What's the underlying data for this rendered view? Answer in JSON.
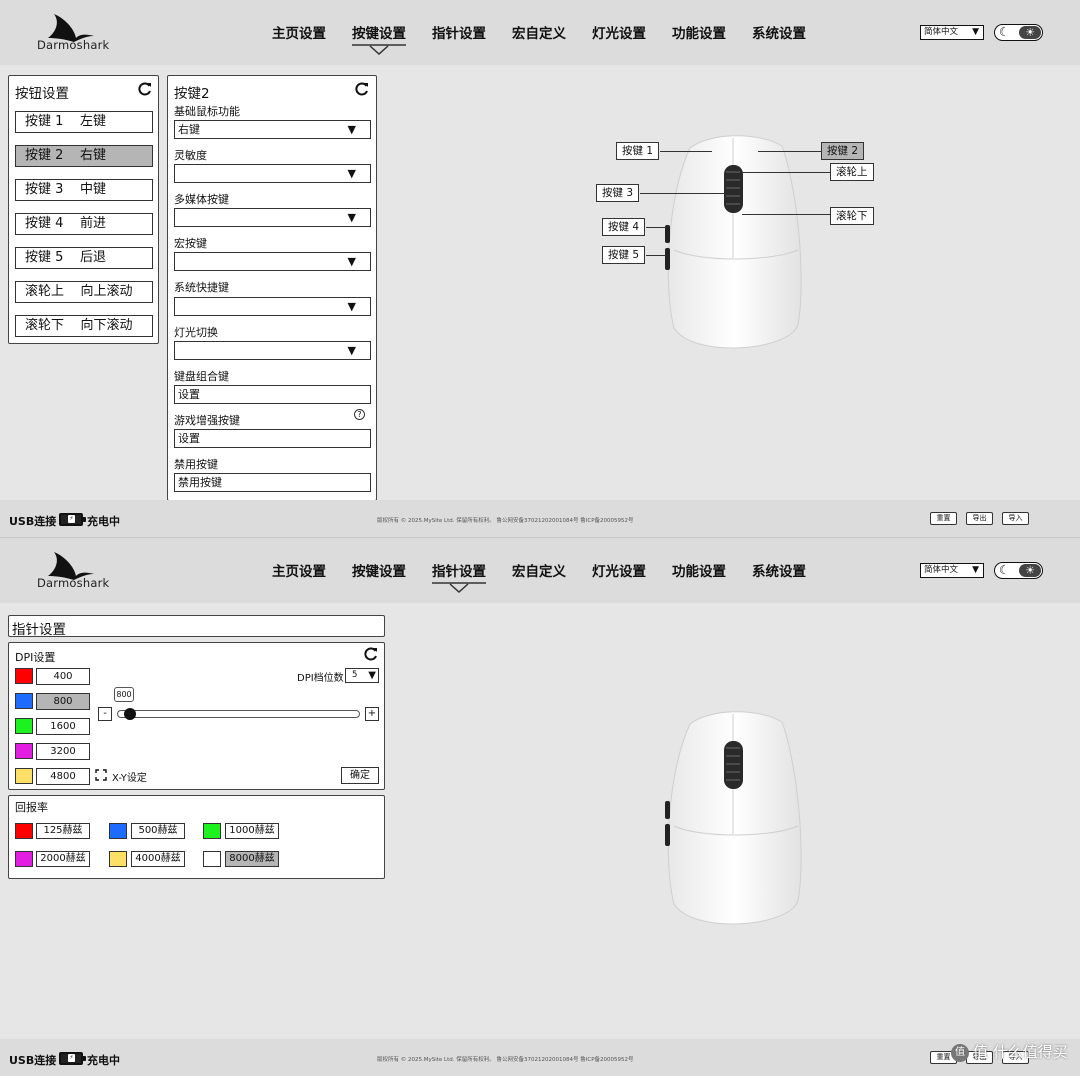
{
  "header": {
    "logo_text": "Darmoshark",
    "nav": [
      "主页设置",
      "按键设置",
      "指针设置",
      "宏自定义",
      "灯光设置",
      "功能设置",
      "系统设置"
    ],
    "language": "简体中文"
  },
  "screen1": {
    "active_tab": "按键设置",
    "button_panel": {
      "title": "按钮设置",
      "items": [
        {
          "key": "按键 1",
          "func": "左键"
        },
        {
          "key": "按键 2",
          "func": "右键"
        },
        {
          "key": "按键 3",
          "func": "中键"
        },
        {
          "key": "按键 4",
          "func": "前进"
        },
        {
          "key": "按键 5",
          "func": "后退"
        },
        {
          "key": "滚轮上",
          "func": "向上滚动"
        },
        {
          "key": "滚轮下",
          "func": "向下滚动"
        }
      ],
      "selected_index": 1
    },
    "detail_panel": {
      "title": "按键2",
      "fields": [
        {
          "label": "基础鼠标功能",
          "value": "右键",
          "type": "dropdown"
        },
        {
          "label": "灵敏度",
          "value": "",
          "type": "dropdown"
        },
        {
          "label": "多媒体按键",
          "value": "",
          "type": "dropdown"
        },
        {
          "label": "宏按键",
          "value": "",
          "type": "dropdown"
        },
        {
          "label": "系统快捷键",
          "value": "",
          "type": "dropdown"
        },
        {
          "label": "灯光切换",
          "value": "",
          "type": "dropdown"
        },
        {
          "label": "键盘组合键",
          "value": "设置",
          "type": "button"
        },
        {
          "label": "游戏增强按键",
          "value": "设置",
          "type": "button",
          "help": "?"
        },
        {
          "label": "禁用按键",
          "value": "禁用按键",
          "type": "button"
        }
      ]
    },
    "callouts": {
      "k1": "按键 1",
      "k2": "按键 2",
      "k3": "按键 3",
      "k4": "按键 4",
      "k5": "按键 5",
      "wheel_up": "滚轮上",
      "wheel_down": "滚轮下"
    }
  },
  "screen2": {
    "active_tab": "指针设置",
    "pointer_title": "指针设置",
    "dpi": {
      "title": "DPI设置",
      "levels_label": "DPI档位数",
      "levels_value": "5",
      "values": [
        {
          "value": "400",
          "color": "#ff0000"
        },
        {
          "value": "800",
          "color": "#1e6cff"
        },
        {
          "value": "1600",
          "color": "#1ef21e"
        },
        {
          "value": "3200",
          "color": "#e21ee2"
        },
        {
          "value": "4800",
          "color": "#ffe066"
        }
      ],
      "selected_index": 1,
      "slider_tooltip": "800",
      "slider_level": 0.03,
      "minus": "-",
      "plus": "+",
      "xy_label": "X-Y设定",
      "confirm": "确定"
    },
    "polling": {
      "title": "回报率",
      "items": [
        {
          "value": "125赫兹",
          "color": "#ff0000"
        },
        {
          "value": "500赫兹",
          "color": "#1e6cff"
        },
        {
          "value": "1000赫兹",
          "color": "#1ef21e"
        },
        {
          "value": "2000赫兹",
          "color": "#e21ee2"
        },
        {
          "value": "4000赫兹",
          "color": "#ffe066"
        },
        {
          "value": "8000赫兹",
          "color": "#ffffff"
        }
      ],
      "selected_index": 5
    }
  },
  "footer": {
    "connection": "USB连接",
    "charging": "充电中",
    "copyright": "版权所有 © 2025.MySite Ltd. 保留所有权利。 鲁公网安备37021202001084号 鲁ICP备20005952号",
    "buttons": [
      "重置",
      "导出",
      "导入"
    ]
  },
  "watermark": "值 什么值得买",
  "colors": {
    "background": "#e6e6e6",
    "header": "#dcdcdc",
    "selected": "#b5b5b5"
  }
}
